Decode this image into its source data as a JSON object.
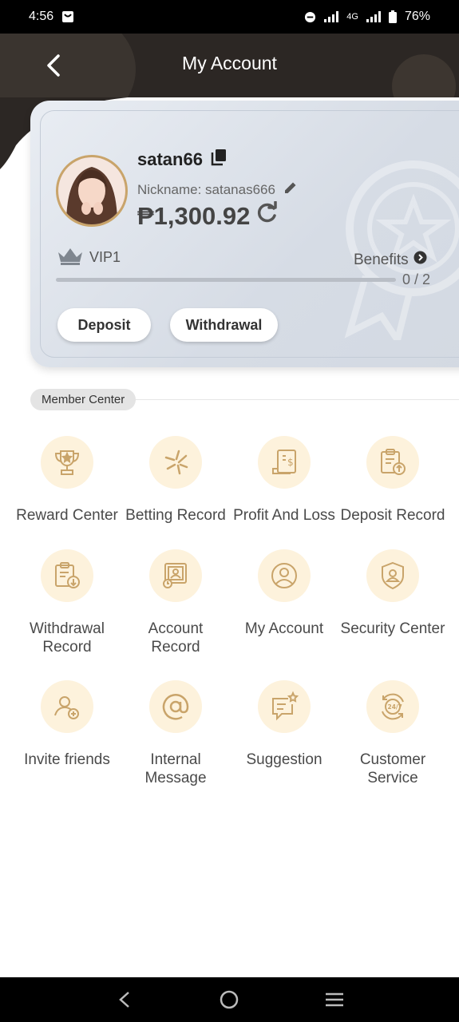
{
  "status_bar": {
    "time": "4:56",
    "network": "4G",
    "battery": "76%"
  },
  "header": {
    "title": "My Account"
  },
  "account": {
    "username": "satan66",
    "nickname": "Nickname: satanas666",
    "balance": "₱1,300.92",
    "vip_level": "VIP1",
    "benefits_label": "Benefits",
    "progress_text": "0 / 2",
    "progress_fraction": 0,
    "deposit_label": "Deposit",
    "withdrawal_label": "Withdrawal"
  },
  "member_center": {
    "title": "Member Center",
    "items": [
      {
        "label": "Reward Center",
        "icon": "trophy-icon"
      },
      {
        "label": "Betting Record",
        "icon": "stars-icon"
      },
      {
        "label": "Profit And Loss",
        "icon": "bill-icon"
      },
      {
        "label": "Deposit Record",
        "icon": "clipboard-upload-icon"
      },
      {
        "label": "Withdrawal\nRecord",
        "icon": "clipboard-download-icon"
      },
      {
        "label": "Account\nRecord",
        "icon": "account-record-icon"
      },
      {
        "label": "My Account",
        "icon": "user-icon"
      },
      {
        "label": "Security Center",
        "icon": "shield-user-icon"
      },
      {
        "label": "Invite friends",
        "icon": "add-user-icon"
      },
      {
        "label": "Internal\nMessage",
        "icon": "at-icon"
      },
      {
        "label": "Suggestion",
        "icon": "message-star-icon"
      },
      {
        "label": "Customer\nService",
        "icon": "24-7-icon"
      }
    ]
  },
  "colors": {
    "header_bg": "#2c2724",
    "icon_gold": "#c9a46a",
    "icon_circle_bg": "#fdf2dc"
  }
}
